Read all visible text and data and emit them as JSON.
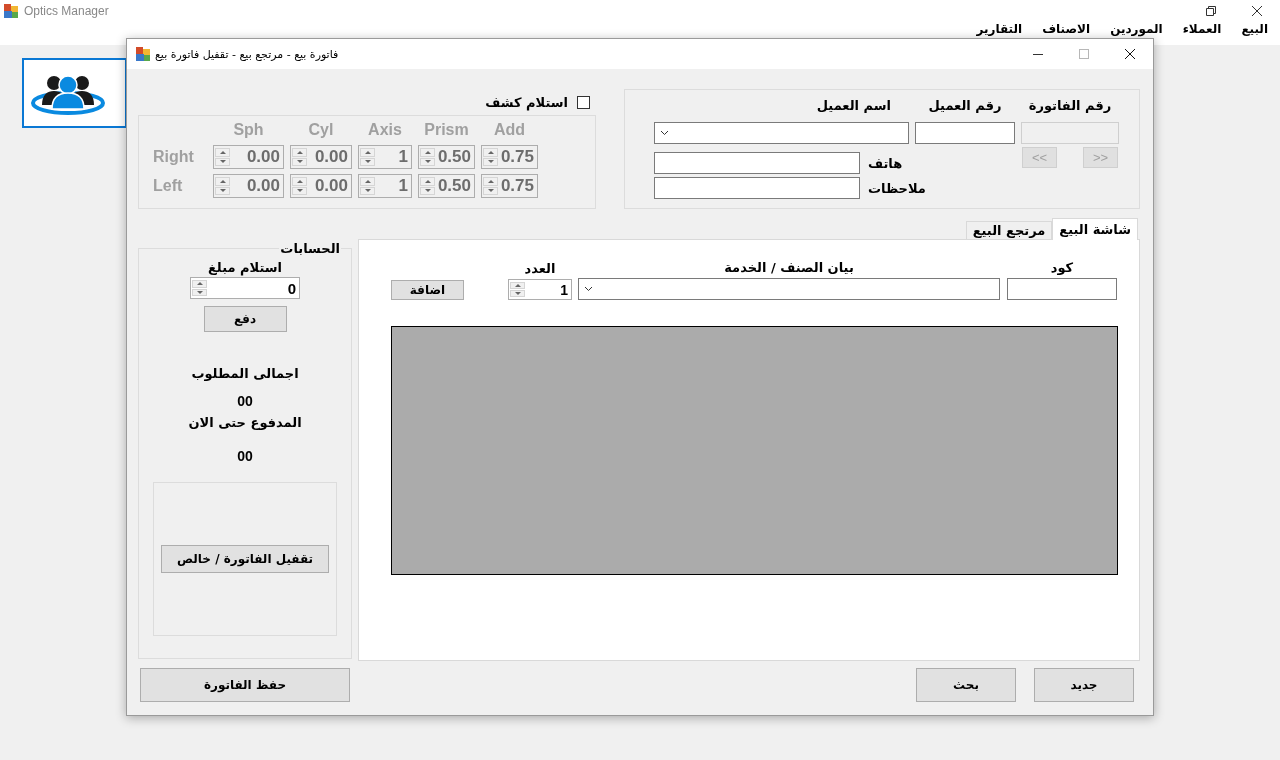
{
  "app": {
    "title": "Optics Manager",
    "menu": [
      {
        "label": "البيع"
      },
      {
        "label": "العملاء"
      },
      {
        "label": "الموردين"
      },
      {
        "label": "الاصناف"
      },
      {
        "label": "التقارير"
      }
    ]
  },
  "dialog": {
    "title": "فاتورة بيع - مرتجع بيع - تقفيل فاتورة بيع",
    "maximize_disabled": true
  },
  "prescription": {
    "received_label": "استلام كشف",
    "received_checked": false,
    "disabled": true,
    "columns": [
      "Add",
      "Prism",
      "Axis",
      "Cyl",
      "Sph"
    ],
    "rows": [
      {
        "label": "Right",
        "values": [
          "0.75",
          "0.50",
          "1",
          "0.00",
          "0.00"
        ]
      },
      {
        "label": "Left",
        "values": [
          "0.75",
          "0.50",
          "1",
          "0.00",
          "0.00"
        ]
      }
    ]
  },
  "customer": {
    "invoice_no_label": "رقم الفاتورة",
    "invoice_no_disabled": true,
    "customer_no_label": "رقم العميل",
    "customer_name_label": "اسم العميل",
    "phone_label": "هاتف",
    "notes_label": "ملاحظات",
    "nav": [
      {
        "label": ">>",
        "disabled": true
      },
      {
        "label": "<<",
        "disabled": true
      }
    ]
  },
  "accounts": {
    "title": "الحسابات",
    "receive_label": "استلام مبلغ",
    "receive_value": "0",
    "pay_button": "دفع",
    "total_label": "اجمالى المطلوب",
    "total_value": "00",
    "paid_label": "المدفوع حتى الان",
    "paid_value": "00",
    "close_button": "تقفيل الفاتورة / خالص"
  },
  "tabs": [
    {
      "label": "شاشة البيع",
      "selected": true
    },
    {
      "label": "مرتجع البيع",
      "selected": false
    }
  ],
  "sale": {
    "code_label": "كود",
    "item_label": "بيان الصنف / الخدمة",
    "qty_label": "العدد",
    "qty_value": "1",
    "add_button": "اضافة"
  },
  "buttons": {
    "save": "حفظ الفاتورة",
    "search": "بحث",
    "new": "جديد"
  }
}
